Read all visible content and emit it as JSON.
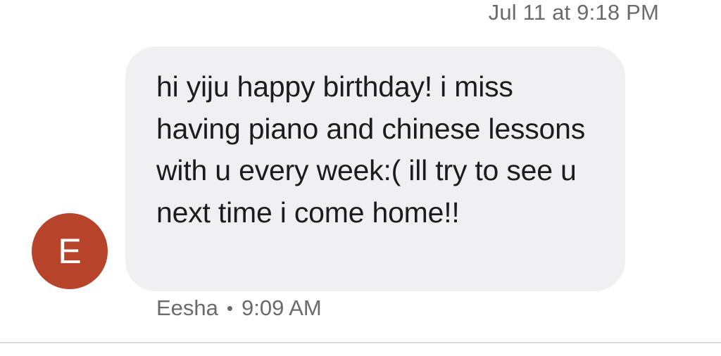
{
  "header": {
    "date_time": "Jul 11 at 9:18 PM"
  },
  "message": {
    "avatar_initial": "E",
    "avatar_color": "#b7432a",
    "text": "hi yiju happy birthday! i miss having piano and chinese lessons with u every week:( ill try to see u next time i come home!!",
    "bubble_color": "#f0f0f2",
    "sender": "Eesha",
    "separator": "•",
    "time": "9:09 AM"
  }
}
